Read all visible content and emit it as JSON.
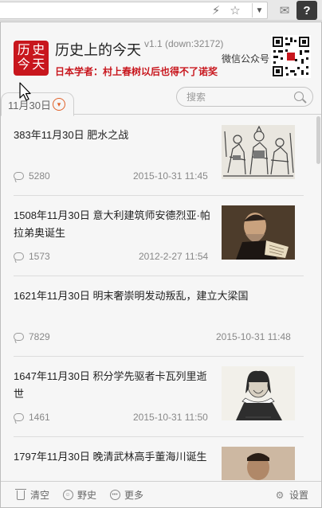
{
  "browser": {
    "bolt_icon": "lightning-icon",
    "star_icon": "star-icon",
    "mail_icon": "mail-icon",
    "extension_label": "?"
  },
  "header": {
    "logo_chars": [
      "历",
      "史",
      "今",
      "天"
    ],
    "title": "历史上的今天",
    "version": "v1.1 (down:32172)",
    "tagline": "日本学者：村上春树以后也得不了诺奖",
    "wechat_label": "微信公众号"
  },
  "tabs": {
    "date_label": "11月30日"
  },
  "search": {
    "placeholder": "搜索"
  },
  "feed": [
    {
      "title": "383年11月30日 肥水之战",
      "comments": "5280",
      "date": "2015-10-31 11:45",
      "has_thumb": true
    },
    {
      "title": "1508年11月30日 意大利建筑师安德烈亚·帕拉弟奥诞生",
      "comments": "1573",
      "date": "2012-2-27 11:54",
      "has_thumb": true
    },
    {
      "title": "1621年11月30日 明末奢崇明发动叛乱，建立大梁国",
      "comments": "7829",
      "date": "2015-10-31 11:48",
      "has_thumb": false
    },
    {
      "title": "1647年11月30日 积分学先驱者卡瓦列里逝世",
      "comments": "1461",
      "date": "2015-10-31 11:50",
      "has_thumb": true
    },
    {
      "title": "1797年11月30日 晚清武林高手董海川诞生",
      "comments": "",
      "date": "",
      "has_thumb": true
    }
  ],
  "footer": {
    "clear": "清空",
    "wild_history": "野史",
    "more": "更多",
    "settings": "设置"
  },
  "colors": {
    "brand_red": "#c8161d",
    "accent_orange": "#e0622a"
  }
}
